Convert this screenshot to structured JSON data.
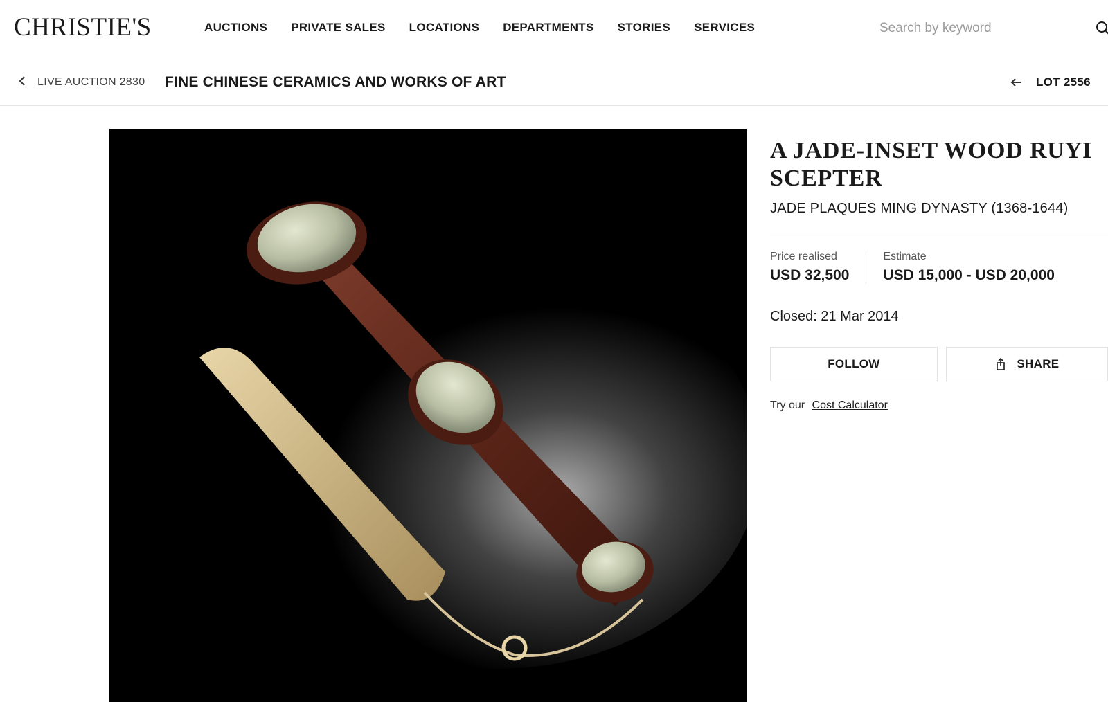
{
  "brand": {
    "logo_text": "CHRISTIE'S"
  },
  "nav": {
    "items": [
      {
        "label": "AUCTIONS"
      },
      {
        "label": "PRIVATE SALES"
      },
      {
        "label": "LOCATIONS"
      },
      {
        "label": "DEPARTMENTS"
      },
      {
        "label": "STORIES"
      },
      {
        "label": "SERVICES"
      }
    ],
    "search_placeholder": "Search by keyword",
    "search_icon": "search-icon"
  },
  "breadcrumb": {
    "back_icon": "chevron-left-icon",
    "live_auction_label": "LIVE AUCTION 2830",
    "auction_title": "FINE CHINESE CERAMICS AND WORKS OF ART",
    "lot_back_icon": "arrow-left-icon",
    "lot_label": "LOT 2556"
  },
  "lot": {
    "title": "A JADE-INSET WOOD RUYI SCEPTER",
    "subtitle": "JADE PLAQUES MING DYNASTY (1368-1644)",
    "price_realised_label": "Price realised",
    "price_realised_value": "USD 32,500",
    "estimate_label": "Estimate",
    "estimate_value": "USD 15,000 - USD 20,000",
    "closed_label": "Closed:",
    "closed_value": "21 Mar 2014",
    "follow_label": "FOLLOW",
    "share_label": "SHARE",
    "share_icon": "share-icon",
    "calc_prefix": "Try our",
    "calc_link": "Cost Calculator"
  },
  "colors": {
    "text": "#1a1a1a",
    "divider": "#e6e6e6",
    "photo_background": "#000000"
  }
}
